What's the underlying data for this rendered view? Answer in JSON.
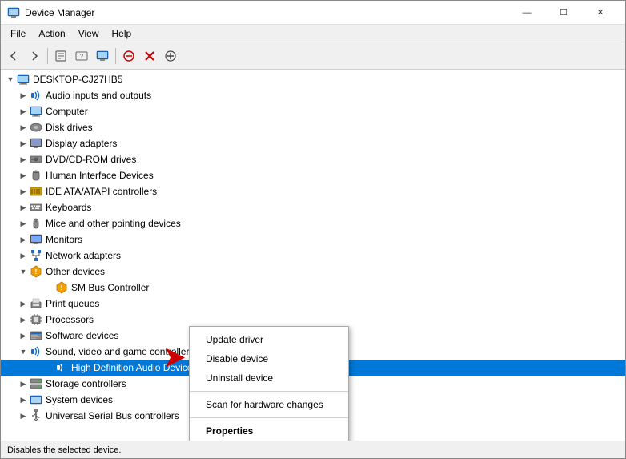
{
  "window": {
    "title": "Device Manager",
    "icon": "🖥",
    "controls": {
      "minimize": "—",
      "maximize": "☐",
      "close": "✕"
    }
  },
  "menubar": {
    "items": [
      "File",
      "Action",
      "View",
      "Help"
    ]
  },
  "toolbar": {
    "buttons": [
      "←",
      "→",
      "⊞",
      "⊟",
      "?",
      "⊞",
      "🖥",
      "✕",
      "⬇"
    ]
  },
  "tree": {
    "root": {
      "label": "DESKTOP-CJ27HB5",
      "expanded": true,
      "children": [
        {
          "id": "audio",
          "label": "Audio inputs and outputs",
          "icon": "🔊",
          "expanded": false
        },
        {
          "id": "computer",
          "label": "Computer",
          "icon": "💻",
          "expanded": false
        },
        {
          "id": "disk",
          "label": "Disk drives",
          "icon": "💾",
          "expanded": false
        },
        {
          "id": "display",
          "label": "Display adapters",
          "icon": "🖥",
          "expanded": false
        },
        {
          "id": "dvd",
          "label": "DVD/CD-ROM drives",
          "icon": "💿",
          "expanded": false
        },
        {
          "id": "hid",
          "label": "Human Interface Devices",
          "icon": "🎮",
          "expanded": false
        },
        {
          "id": "ide",
          "label": "IDE ATA/ATAPI controllers",
          "icon": "⚙",
          "expanded": false
        },
        {
          "id": "keyboards",
          "label": "Keyboards",
          "icon": "⌨",
          "expanded": false
        },
        {
          "id": "mice",
          "label": "Mice and other pointing devices",
          "icon": "🖱",
          "expanded": false
        },
        {
          "id": "monitors",
          "label": "Monitors",
          "icon": "🖥",
          "expanded": false
        },
        {
          "id": "network",
          "label": "Network adapters",
          "icon": "🌐",
          "expanded": false
        },
        {
          "id": "other",
          "label": "Other devices",
          "icon": "❓",
          "expanded": true
        },
        {
          "id": "sm_bus",
          "label": "SM Bus Controller",
          "icon": "⚠",
          "expanded": false,
          "indent": 2
        },
        {
          "id": "print",
          "label": "Print queues",
          "icon": "🖨",
          "expanded": false
        },
        {
          "id": "processors",
          "label": "Processors",
          "icon": "⚙",
          "expanded": false
        },
        {
          "id": "software",
          "label": "Software devices",
          "icon": "📦",
          "expanded": false
        },
        {
          "id": "sound",
          "label": "Sound, video and game controllers",
          "icon": "🔊",
          "expanded": true
        },
        {
          "id": "hd_audio",
          "label": "High Definition Audio Device",
          "icon": "🔊",
          "expanded": false,
          "indent": 2,
          "selected": true
        },
        {
          "id": "storage",
          "label": "Storage controllers",
          "icon": "💾",
          "expanded": false
        },
        {
          "id": "system",
          "label": "System devices",
          "icon": "⚙",
          "expanded": false
        },
        {
          "id": "usb",
          "label": "Universal Serial Bus controllers",
          "icon": "🔌",
          "expanded": false
        }
      ]
    }
  },
  "contextMenu": {
    "items": [
      {
        "id": "update-driver",
        "label": "Update driver",
        "bold": false,
        "separator_after": false
      },
      {
        "id": "disable-device",
        "label": "Disable device",
        "bold": false,
        "separator_after": false
      },
      {
        "id": "uninstall-device",
        "label": "Uninstall device",
        "bold": false,
        "separator_after": true
      },
      {
        "id": "scan-hardware",
        "label": "Scan for hardware changes",
        "bold": false,
        "separator_after": true
      },
      {
        "id": "properties",
        "label": "Properties",
        "bold": true,
        "separator_after": false
      }
    ]
  },
  "statusBar": {
    "text": "Disables the selected device."
  }
}
